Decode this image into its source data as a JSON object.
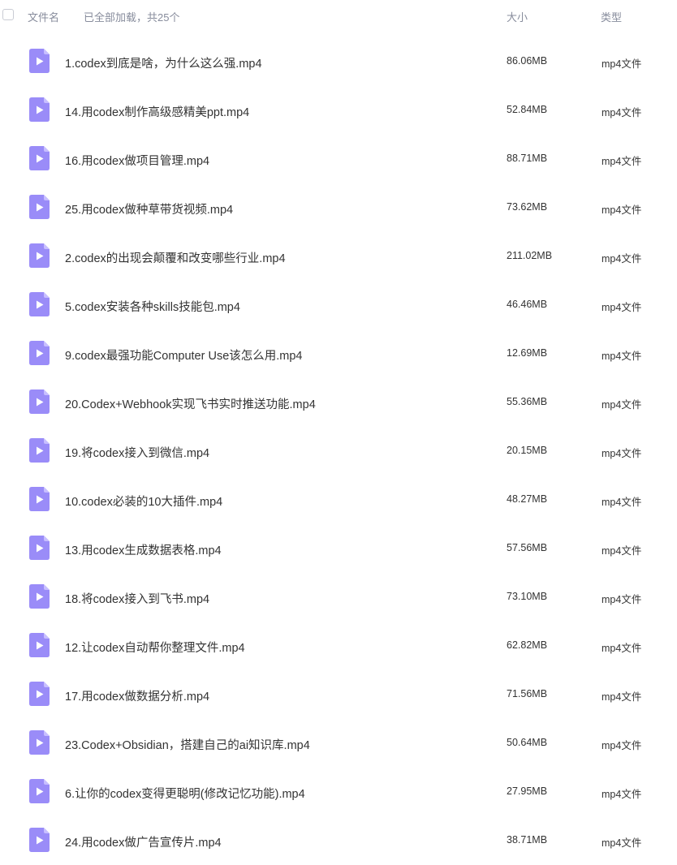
{
  "header": {
    "col_name": "文件名",
    "loaded_text": "已全部加载，共25个",
    "col_size": "大小",
    "col_type": "类型"
  },
  "colors": {
    "icon_purple": "#9a8cf8",
    "header_text": "#878c9c",
    "row_text": "#333333"
  },
  "files": [
    {
      "name": "1.codex到底是啥，为什么这么强.mp4",
      "size": "86.06MB",
      "type": "mp4文件",
      "icon": "video-file-icon"
    },
    {
      "name": "14.用codex制作高级感精美ppt.mp4",
      "size": "52.84MB",
      "type": "mp4文件",
      "icon": "video-file-icon"
    },
    {
      "name": "16.用codex做项目管理.mp4",
      "size": "88.71MB",
      "type": "mp4文件",
      "icon": "video-file-icon"
    },
    {
      "name": "25.用codex做种草带货视频.mp4",
      "size": "73.62MB",
      "type": "mp4文件",
      "icon": "video-file-icon"
    },
    {
      "name": "2.codex的出现会颠覆和改变哪些行业.mp4",
      "size": "211.02MB",
      "type": "mp4文件",
      "icon": "video-file-icon"
    },
    {
      "name": "5.codex安装各种skills技能包.mp4",
      "size": "46.46MB",
      "type": "mp4文件",
      "icon": "video-file-icon"
    },
    {
      "name": "9.codex最强功能Computer Use该怎么用.mp4",
      "size": "12.69MB",
      "type": "mp4文件",
      "icon": "video-file-icon"
    },
    {
      "name": "20.Codex+Webhook实现飞书实时推送功能.mp4",
      "size": "55.36MB",
      "type": "mp4文件",
      "icon": "video-file-icon"
    },
    {
      "name": "19.将codex接入到微信.mp4",
      "size": "20.15MB",
      "type": "mp4文件",
      "icon": "video-file-icon"
    },
    {
      "name": "10.codex必装的10大插件.mp4",
      "size": "48.27MB",
      "type": "mp4文件",
      "icon": "video-file-icon"
    },
    {
      "name": "13.用codex生成数据表格.mp4",
      "size": "57.56MB",
      "type": "mp4文件",
      "icon": "video-file-icon"
    },
    {
      "name": "18.将codex接入到飞书.mp4",
      "size": "73.10MB",
      "type": "mp4文件",
      "icon": "video-file-icon"
    },
    {
      "name": "12.让codex自动帮你整理文件.mp4",
      "size": "62.82MB",
      "type": "mp4文件",
      "icon": "video-file-icon"
    },
    {
      "name": "17.用codex做数据分析.mp4",
      "size": "71.56MB",
      "type": "mp4文件",
      "icon": "video-file-icon"
    },
    {
      "name": "23.Codex+Obsidian，搭建自己的ai知识库.mp4",
      "size": "50.64MB",
      "type": "mp4文件",
      "icon": "video-file-icon"
    },
    {
      "name": "6.让你的codex变得更聪明(修改记忆功能).mp4",
      "size": "27.95MB",
      "type": "mp4文件",
      "icon": "video-file-icon"
    },
    {
      "name": "24.用codex做广告宣传片.mp4",
      "size": "38.71MB",
      "type": "mp4文件",
      "icon": "video-file-icon"
    }
  ]
}
